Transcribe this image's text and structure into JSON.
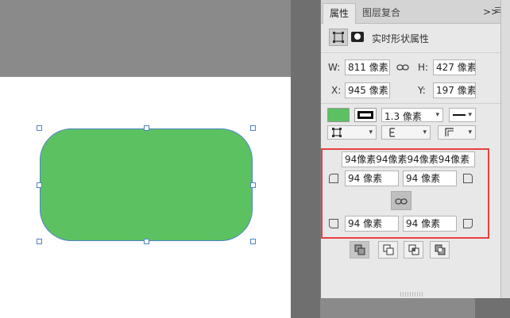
{
  "tabs": [
    {
      "label": "属性"
    },
    {
      "label": "图层复合"
    }
  ],
  "panel": {
    "expand_glyph": ">>",
    "kind_label": "实时形状属性"
  },
  "size": {
    "w_label": "W:",
    "w_value": "811 像素",
    "h_label": "H:",
    "h_value": "427 像素"
  },
  "position": {
    "x_label": "X:",
    "x_value": "945 像素",
    "y_label": "Y:",
    "y_value": "197 像素"
  },
  "appearance": {
    "fill_color": "#5cc261",
    "stroke_width": "1.3 像素"
  },
  "corners": {
    "summary": "94像素94像素94像素94像素",
    "top_left": "94 像素",
    "top_right": "94 像素",
    "bottom_left": "94 像素",
    "bottom_right": "94 像素"
  },
  "colors": {
    "highlight": "#e84040",
    "shape_fill": "#5cc261",
    "selection": "#4f83c9"
  }
}
